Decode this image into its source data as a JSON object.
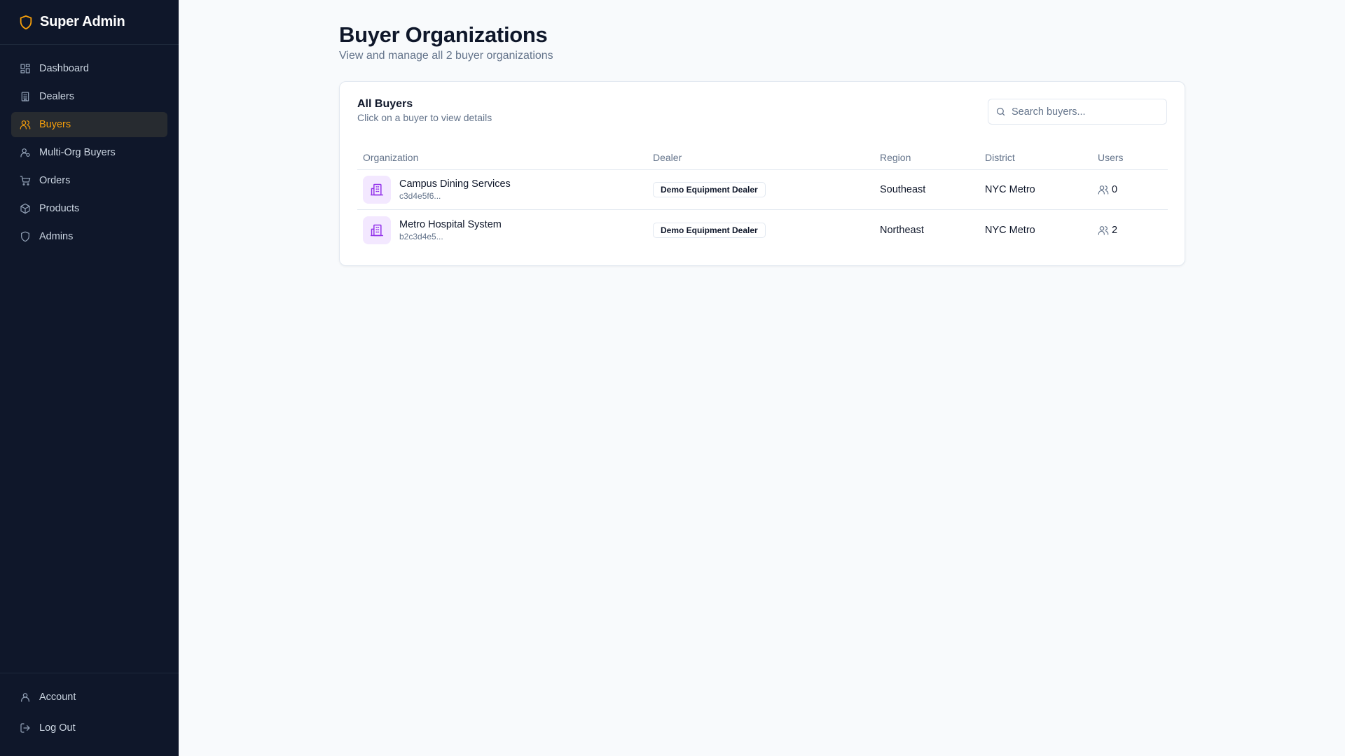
{
  "sidebar": {
    "brand": "Super Admin",
    "brand_icon": "shield-icon",
    "accent_color": "#f59e0b",
    "items": [
      {
        "label": "Dashboard",
        "icon": "dashboard-icon"
      },
      {
        "label": "Dealers",
        "icon": "building-icon"
      },
      {
        "label": "Buyers",
        "icon": "users-icon",
        "active": true
      },
      {
        "label": "Multi-Org Buyers",
        "icon": "user-multi-icon"
      },
      {
        "label": "Orders",
        "icon": "cart-icon"
      },
      {
        "label": "Products",
        "icon": "package-icon"
      },
      {
        "label": "Admins",
        "icon": "shield-icon"
      }
    ],
    "bottom": [
      {
        "label": "Account",
        "icon": "user-icon"
      },
      {
        "label": "Log Out",
        "icon": "logout-icon"
      }
    ]
  },
  "page": {
    "title": "Buyer Organizations",
    "subtitle": "View and manage all 2 buyer organizations"
  },
  "card": {
    "title": "All Buyers",
    "subtitle": "Click on a buyer to view details",
    "search_placeholder": "Search buyers..."
  },
  "table": {
    "headers": [
      "Organization",
      "Dealer",
      "Region",
      "District",
      "Users"
    ],
    "rows": [
      {
        "name": "Campus Dining Services",
        "id": "c3d4e5f6...",
        "dealer": "Demo Equipment Dealer",
        "region": "Southeast",
        "district": "NYC Metro",
        "users": "0"
      },
      {
        "name": "Metro Hospital System",
        "id": "b2c3d4e5...",
        "dealer": "Demo Equipment Dealer",
        "region": "Northeast",
        "district": "NYC Metro",
        "users": "2"
      }
    ]
  }
}
